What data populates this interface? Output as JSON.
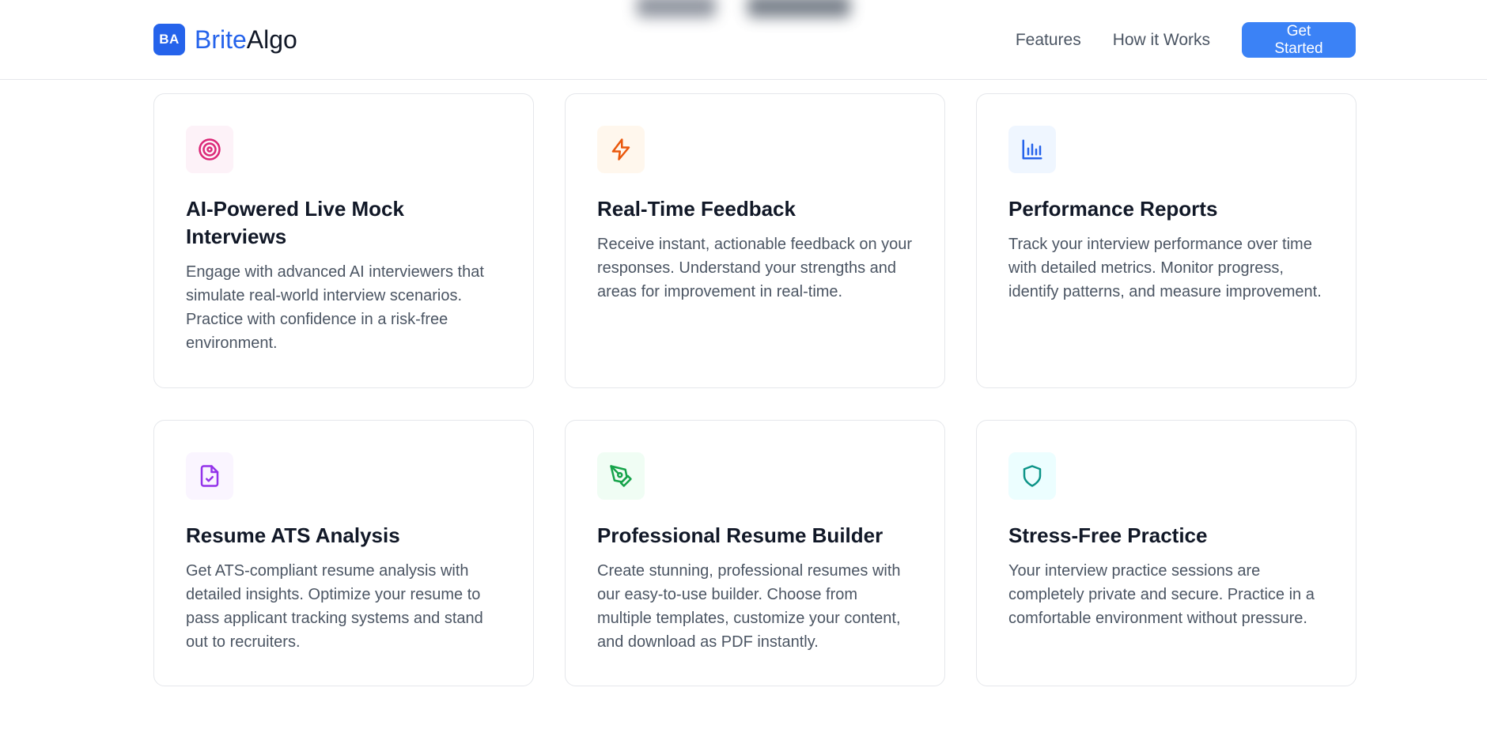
{
  "header": {
    "logo_badge": "BA",
    "logo_brite": "Brite",
    "logo_algo": "Algo",
    "nav": [
      {
        "label": "Features"
      },
      {
        "label": "How it Works"
      }
    ],
    "cta_label": "Get Started"
  },
  "colors": {
    "brand_blue": "#2563eb",
    "cta_blue": "#3b82f6"
  },
  "features": [
    {
      "icon": "target-icon",
      "icon_color": "#db2777",
      "icon_bg": "#fdf2f8",
      "title": "AI-Powered Live Mock Interviews",
      "description": "Engage with advanced AI interviewers that simulate real-world interview scenarios. Practice with confidence in a risk-free environment."
    },
    {
      "icon": "lightning-icon",
      "icon_color": "#ea580c",
      "icon_bg": "#fff7ed",
      "title": "Real-Time Feedback",
      "description": "Receive instant, actionable feedback on your responses. Understand your strengths and areas for improvement in real-time."
    },
    {
      "icon": "bar-chart-icon",
      "icon_color": "#2563eb",
      "icon_bg": "#eff6ff",
      "title": "Performance Reports",
      "description": "Track your interview performance over time with detailed metrics. Monitor progress, identify patterns, and measure improvement."
    },
    {
      "icon": "file-check-icon",
      "icon_color": "#9333ea",
      "icon_bg": "#faf5ff",
      "title": "Resume ATS Analysis",
      "description": "Get ATS-compliant resume analysis with detailed insights. Optimize your resume to pass applicant tracking systems and stand out to recruiters."
    },
    {
      "icon": "pen-tool-icon",
      "icon_color": "#16a34a",
      "icon_bg": "#f0fdf4",
      "title": "Professional Resume Builder",
      "description": "Create stunning, professional resumes with our easy-to-use builder. Choose from multiple templates, customize your content, and download as PDF instantly."
    },
    {
      "icon": "shield-icon",
      "icon_color": "#0d9488",
      "icon_bg": "#ecfeff",
      "title": "Stress-Free Practice",
      "description": "Your interview practice sessions are completely private and secure. Practice in a comfortable environment without pressure."
    }
  ]
}
